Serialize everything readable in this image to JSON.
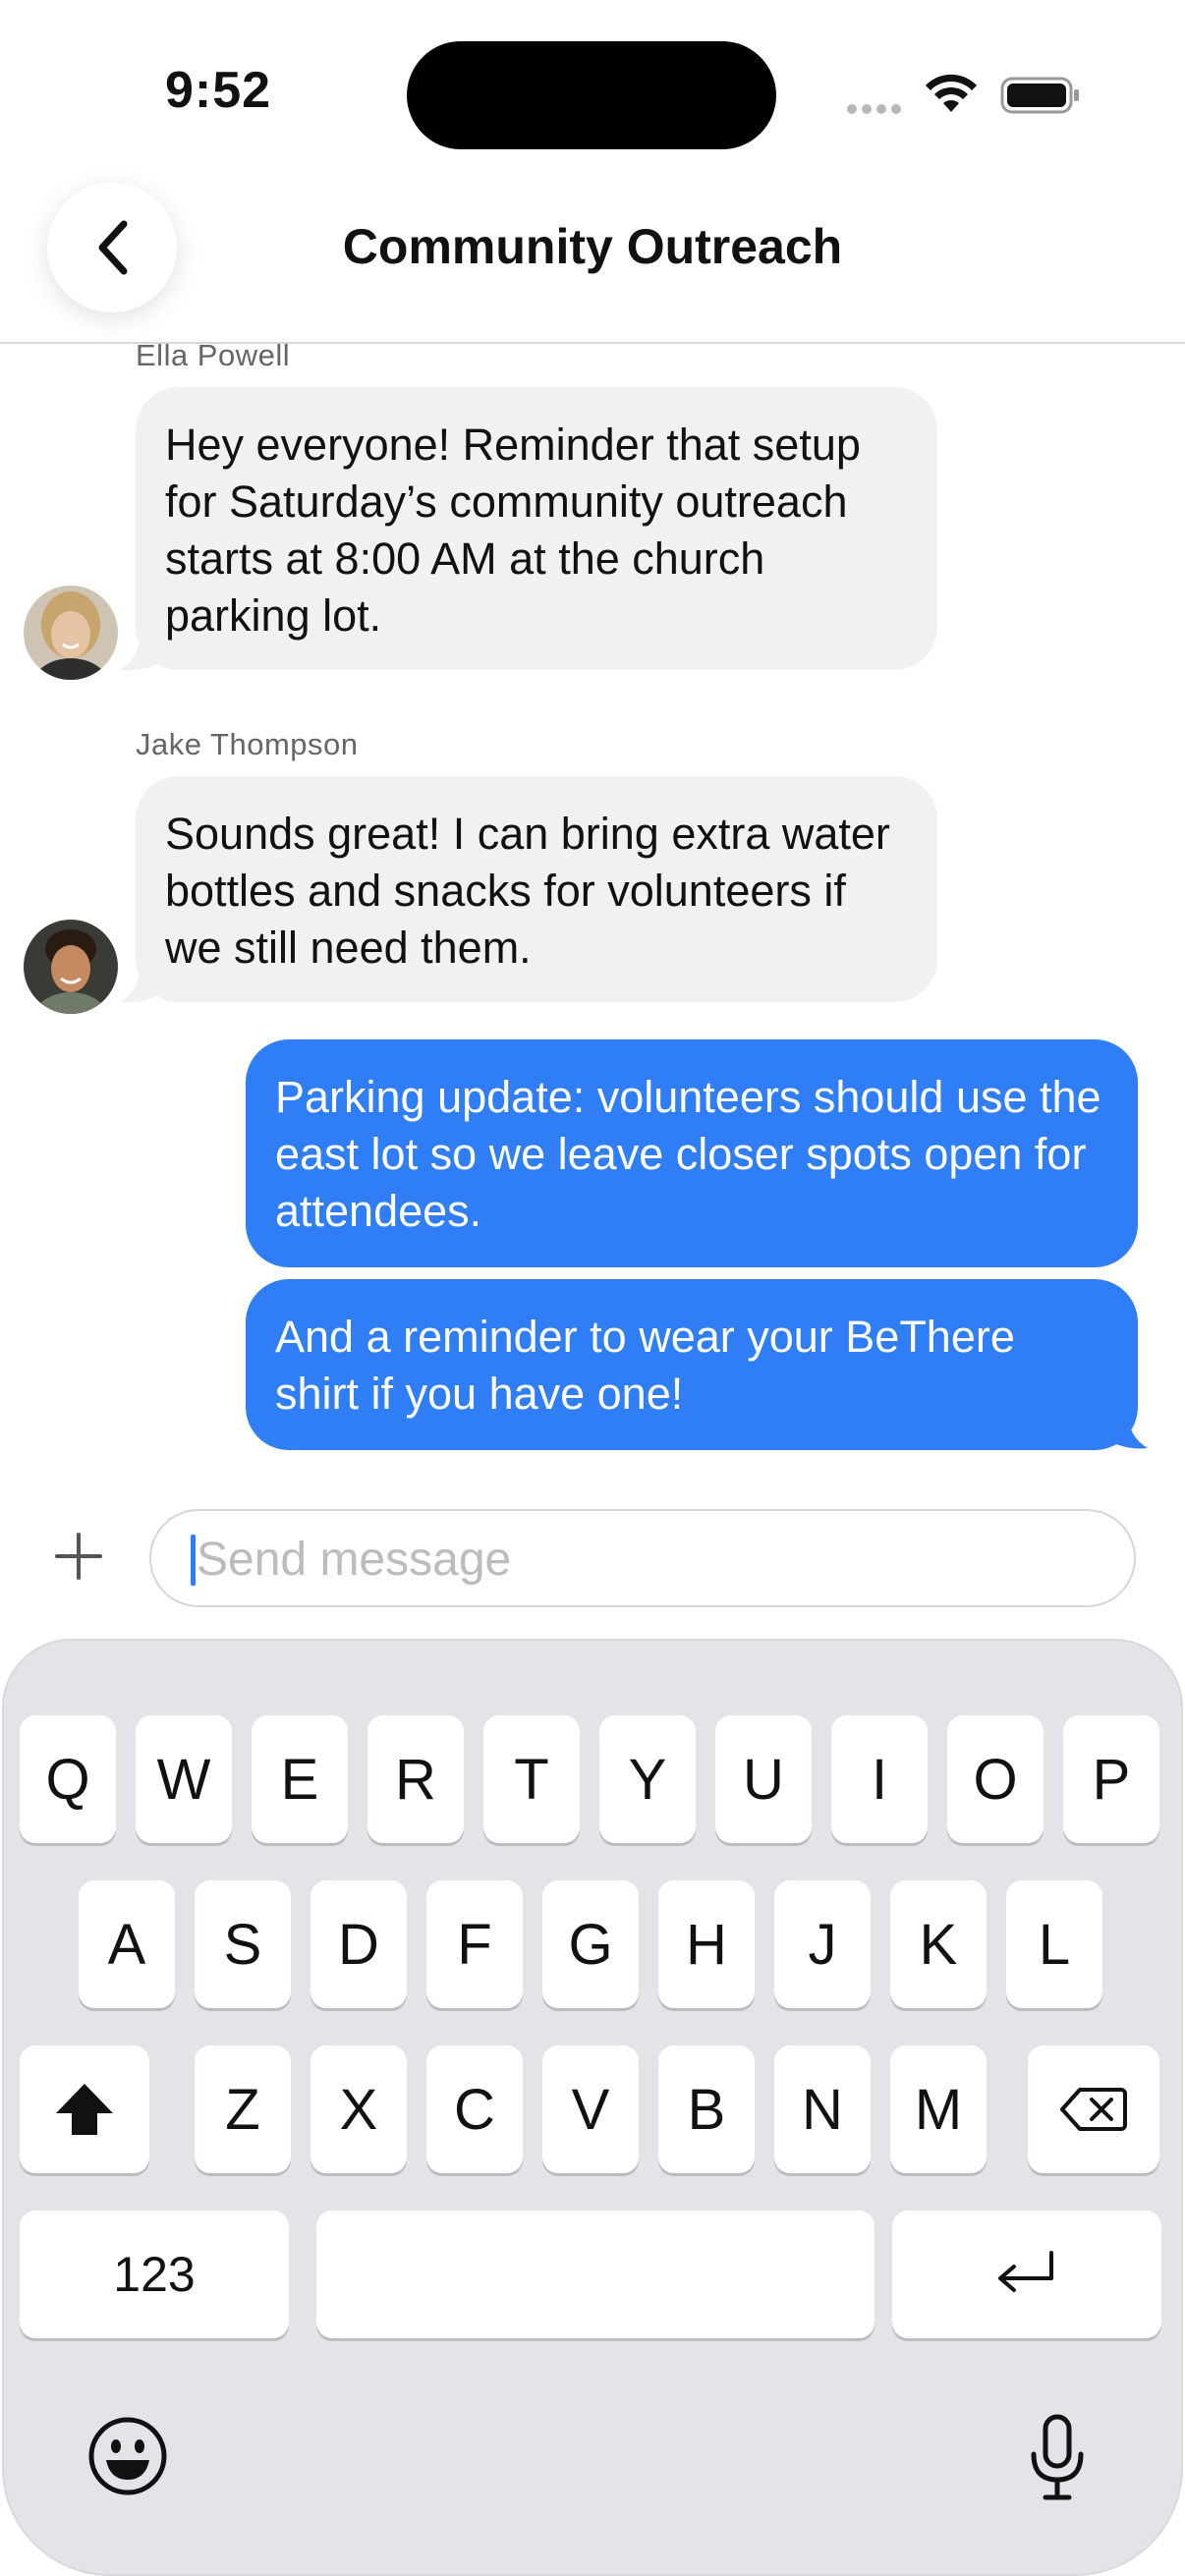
{
  "status_bar": {
    "time": "9:52"
  },
  "header": {
    "title": "Community Outreach"
  },
  "messages": [
    {
      "sender": "Ella Powell",
      "text": "Hey everyone! Reminder that setup for Saturday’s community outreach starts at 8:00 AM at the church parking lot.",
      "direction": "incoming"
    },
    {
      "sender": "Jake Thompson",
      "text": "Sounds great! I can bring extra water bottles and snacks for volunteers if we still need them.",
      "direction": "incoming"
    },
    {
      "text": "Parking update: volunteers should use the east lot so we leave closer spots open for attendees.",
      "direction": "outgoing"
    },
    {
      "text": "And a reminder to wear your BeThere shirt if you have one!",
      "direction": "outgoing"
    }
  ],
  "composer": {
    "placeholder": "Send message",
    "value": ""
  },
  "keyboard": {
    "row1": [
      "Q",
      "W",
      "E",
      "R",
      "T",
      "Y",
      "U",
      "I",
      "O",
      "P"
    ],
    "row2": [
      "A",
      "S",
      "D",
      "F",
      "G",
      "H",
      "J",
      "K",
      "L"
    ],
    "row3": [
      "Z",
      "X",
      "C",
      "V",
      "B",
      "N",
      "M"
    ],
    "numbers_label": "123"
  },
  "colors": {
    "outgoing_bubble": "#2f7ef5",
    "incoming_bubble": "#f1f1f2",
    "keyboard_bg": "#e3e4e8"
  },
  "icons": [
    "back-chevron-icon",
    "wifi-icon",
    "battery-icon",
    "plus-icon",
    "shift-icon",
    "delete-icon",
    "return-icon",
    "emoji-icon",
    "microphone-icon"
  ]
}
